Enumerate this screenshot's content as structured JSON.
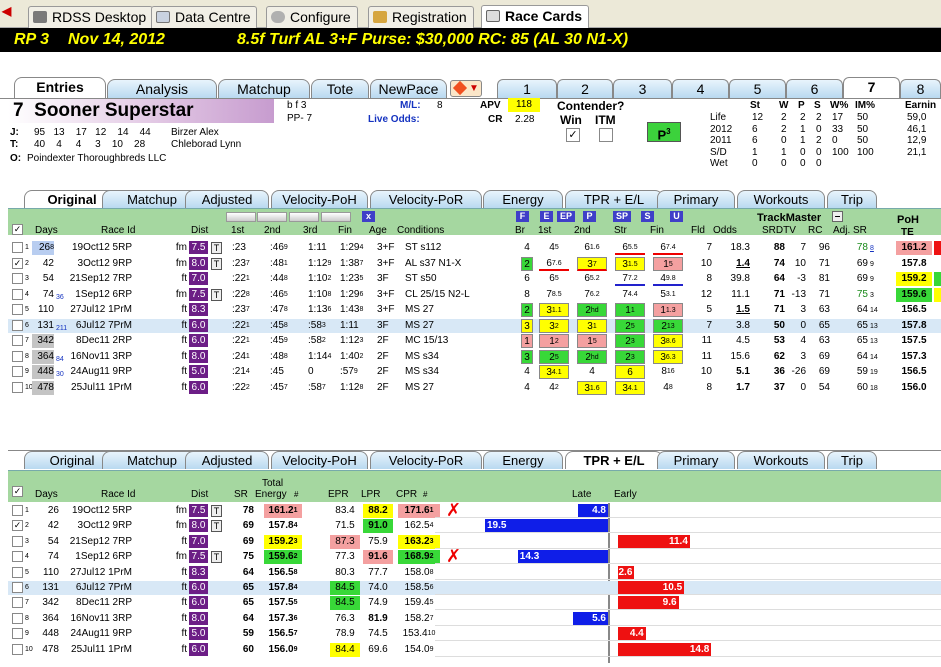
{
  "app_tabs": [
    {
      "label": "RDSS Desktop",
      "icon": "house-icon"
    },
    {
      "label": "Data Centre",
      "icon": "document-icon"
    },
    {
      "label": "Configure",
      "icon": "gear-icon"
    },
    {
      "label": "Registration",
      "icon": "key-icon"
    },
    {
      "label": "Race Cards",
      "icon": "card-icon"
    }
  ],
  "header": {
    "race": "RP  3",
    "date": "Nov 14, 2012",
    "info": "8.5f  Turf  AL  3+F   Purse: $30,000   RC: 85  (AL 30 N1-X)"
  },
  "entry_tabs": [
    "Entries",
    "Analysis",
    "Matchup",
    "Tote",
    "NewPace"
  ],
  "num_tabs": [
    "1",
    "2",
    "3",
    "4",
    "5",
    "6",
    "7",
    "8"
  ],
  "horse": {
    "num": "7",
    "name": "Sooner Superstar",
    "sex": "b f 3",
    "pp": "PP- 7",
    "ml_label": "M/L:",
    "ml": "8",
    "live_label": "Live Odds:",
    "apv_label": "APV",
    "apv": "118",
    "cr_label": "CR",
    "cr": "2.28",
    "contender": "Contender?",
    "win": "Win",
    "itm": "ITM",
    "p3": "P",
    "p3_sup": "3",
    "jockey_label": "J:",
    "jockey_stats": "95   13    17   12    14    44",
    "jockey": "Birzer Alex",
    "trainer_label": "T:",
    "trainer_stats": "40    4     4     3    10    28",
    "trainer": "Chleborad Lynn",
    "owner_label": "O:",
    "owner": "Poindexter Thoroughbreds LLC"
  },
  "record": {
    "headers": [
      "St",
      "W",
      "P",
      "S",
      "W%",
      "IM%",
      "Earnin"
    ],
    "rows": [
      {
        "label": "Life",
        "vals": [
          "12",
          "2",
          "2",
          "2",
          "17",
          "50",
          "59,0"
        ]
      },
      {
        "label": "2012",
        "vals": [
          "6",
          "2",
          "1",
          "0",
          "33",
          "50",
          "46,1"
        ]
      },
      {
        "label": "2011",
        "vals": [
          "6",
          "0",
          "1",
          "2",
          "0",
          "50",
          "12,9"
        ]
      },
      {
        "label": "S/D",
        "vals": [
          "1",
          "1",
          "0",
          "0",
          "100",
          "100",
          "21,1"
        ]
      },
      {
        "label": "Wet",
        "vals": [
          "0",
          "0",
          "0",
          "0",
          "",
          "",
          " "
        ]
      }
    ]
  },
  "form_tabs": [
    "Original",
    "Matchup",
    "Adjusted",
    "Velocity-PoH",
    "Velocity-PoR",
    "Energy",
    "TPR + E/L",
    "Primary",
    "Workouts",
    "Trip"
  ],
  "top_grid": {
    "headers": {
      "days": "Days",
      "raceid": "Race Id",
      "dist": "Dist",
      "c1st": "1st",
      "c2nd": "2nd",
      "c3rd": "3rd",
      "fin": "Fin",
      "age": "Age",
      "cond": "Conditions",
      "br": "Br",
      "b1st": "1st",
      "b2nd": "2nd",
      "str": "Str",
      "bfin": "Fin",
      "fld": "Fld",
      "odds": "Odds",
      "tm": "TrackMaster",
      "srdtv": "SRDTV",
      "rc": "RC",
      "adjsr": "Adj. SR",
      "poh": "PoH",
      "te": "TE",
      "x": "x",
      "F": "F",
      "E": "E",
      "EP": "EP",
      "P": "P",
      "SP": "SP",
      "S": "S",
      "U": "U",
      "minus": "–"
    },
    "rows": [
      {
        "n": "1",
        "days": "26",
        "dsup": "8",
        "rid": "19Oct12 5RP",
        "sf": "fm",
        "dist": "7.5",
        "t": "T",
        "f1": ":23",
        "f2": ":46",
        "f2s": "9",
        "f3": "1:11",
        "fin": "1:29",
        "fins": "4",
        "age": "3+F",
        "cond": "ST s112",
        "br": "4",
        "p1": "4",
        "p1s": "5",
        "p2": "6",
        "p2s": "1.6",
        "st": "6",
        "sts": "5.5",
        "pf": "6",
        "pfs": "7.4",
        "fld": "7",
        "odds": "18.3",
        "sr": "88",
        "dtv": "7",
        "rc": "96",
        "adj": "78",
        "adjs": "8",
        "poh": "161.2",
        "te": ""
      },
      {
        "n": "2",
        "chk": "✓",
        "days": "42",
        "rid": "3Oct12 9RP",
        "sf": "fm",
        "dist": "8.0",
        "t": "T",
        "f1": ":23",
        "f1s": "7",
        "f2": ":48",
        "f2s": "1",
        "f3": "1:12",
        "f3s": "9",
        "fin": "1:38",
        "fins": "7",
        "age": "3+F",
        "cond": "AL s37 N1-X",
        "br": "2",
        "p1": "6",
        "p1s": "7.6",
        "p2": "3",
        "p2s": "7",
        "st": "3",
        "sts": "1.5",
        "pf": "1",
        "pfs": "5",
        "fld": "10",
        "odds": "1.4",
        "sr": "74",
        "dtv": "10",
        "rc": "71",
        "adj": "69",
        "adjs": "9",
        "poh": "157.8",
        "te": ""
      },
      {
        "n": "3",
        "days": "54",
        "rid": "21Sep12 7RP",
        "sf": "ft",
        "dist": "7.0",
        "t": "",
        "f1": ":22",
        "f1s": "1",
        "f2": ":44",
        "f2s": "8",
        "f3": "1:10",
        "f3s": "2",
        "fin": "1:23",
        "fins": "5",
        "age": "3F",
        "cond": "ST s50",
        "br": "6",
        "p1": "6",
        "p1s": "5",
        "p2": "6",
        "p2s": "5.2",
        "st": "7",
        "sts": "7.2",
        "pf": "4",
        "pfs": "9.8",
        "fld": "8",
        "odds": "39.8",
        "sr": "64",
        "dtv": "-3",
        "rc": "81",
        "adj": "69",
        "adjs": "9",
        "poh": "159.2",
        "te": ""
      },
      {
        "n": "4",
        "days": "74",
        "dsup2": "36",
        "rid": "1Sep12 6RP",
        "sf": "fm",
        "dist": "7.5",
        "t": "T",
        "f1": ":22",
        "f1s": "8",
        "f2": ":46",
        "f2s": "5",
        "f3": "1:10",
        "f3s": "8",
        "fin": "1:29",
        "fins": "6",
        "age": "3+F",
        "cond": "CL 25/15 N2-L",
        "br": "8",
        "p1": "7",
        "p1s": "8.5",
        "p2": "7",
        "p2s": "6.2",
        "st": "7",
        "sts": "4.4",
        "pf": "5",
        "pfs": "3.1",
        "fld": "12",
        "odds": "11.1",
        "sr": "71",
        "dtv": "-13",
        "rc": "71",
        "adj": "75",
        "adjs": "3",
        "poh": "159.6",
        "te": ""
      },
      {
        "n": "5",
        "days": "110",
        "rid": "27Jul12 1PrM",
        "sf": "ft",
        "dist": "8.3",
        "t": "",
        "f1": ":23",
        "f1s": "7",
        "f2": ":47",
        "f2s": "8",
        "f3": "1:13",
        "f3s": "6",
        "fin": "1:43",
        "fins": "8",
        "age": "3+F",
        "cond": "MS 27",
        "br": "2",
        "p1": "3",
        "p1s": "1.1",
        "p2": "2",
        "p2s": "hd",
        "st": "1",
        "sts": "1",
        "pf": "1",
        "pfs": "1.3",
        "fld": "5",
        "odds": "1.5",
        "sr": "71",
        "dtv": "3",
        "rc": "63",
        "adj": "64",
        "adjs": "14",
        "poh": "156.5",
        "te": ""
      },
      {
        "n": "6",
        "days": "131",
        "dsup2": "211",
        "rid": "6Jul12 7PrM",
        "sf": "ft",
        "dist": "6.0",
        "t": "",
        "f1": ":22",
        "f1s": "1",
        "f2": ":45",
        "f2s": "8",
        "f3": ":58",
        "f3s": "3",
        "fin": "1:11",
        "fins": "",
        "age": "3F",
        "cond": "MS 27",
        "br": "3",
        "p1": "3",
        "p1s": "2",
        "p2": "3",
        "p2s": "1",
        "st": "2",
        "sts": "5",
        "pf": "2",
        "pfs": "13",
        "fld": "7",
        "odds": "3.8",
        "sr": "50",
        "dtv": "0",
        "rc": "65",
        "adj": "65",
        "adjs": "13",
        "poh": "157.8",
        "te": ""
      },
      {
        "n": "7",
        "days": "342",
        "rid": "8Dec11 2RP",
        "sf": "ft",
        "dist": "6.0",
        "t": "",
        "f1": ":22",
        "f1s": "1",
        "f2": ":45",
        "f2s": "9",
        "f3": ":58",
        "f3s": "2",
        "fin": "1:12",
        "fins": "3",
        "age": "2F",
        "cond": "MC 15/13",
        "br": "1",
        "p1": "1",
        "p1s": "2",
        "p2": "1",
        "p2s": "5",
        "st": "2",
        "sts": "3",
        "pf": "3",
        "pfs": "8.6",
        "fld": "11",
        "odds": "4.5",
        "sr": "53",
        "dtv": "4",
        "rc": "63",
        "adj": "65",
        "adjs": "13",
        "poh": "157.5",
        "te": ""
      },
      {
        "n": "8",
        "days": "364",
        "dsup2": "84",
        "rid": "16Nov11 3RP",
        "sf": "ft",
        "dist": "8.0",
        "t": "",
        "f1": ":24",
        "f1s": "1",
        "f2": ":48",
        "f2s": "8",
        "f3": "1:14",
        "f3s": "4",
        "fin": "1:40",
        "fins": "2",
        "age": "2F",
        "cond": "MS s34",
        "br": "3",
        "p1": "2",
        "p1s": "5",
        "p2": "2",
        "p2s": "hd",
        "st": "2",
        "sts": "3",
        "pf": "3",
        "pfs": "6.3",
        "fld": "11",
        "odds": "15.6",
        "sr": "62",
        "dtv": "3",
        "rc": "69",
        "adj": "64",
        "adjs": "14",
        "poh": "157.3",
        "te": ""
      },
      {
        "n": "9",
        "days": "448",
        "dsup2": "30",
        "rid": "24Aug11 9RP",
        "sf": "ft",
        "dist": "5.0",
        "t": "",
        "f1": ":21",
        "f1s": "4",
        "f2": ":45",
        "f2s": "",
        "f3": "0",
        "f3s": "",
        "fin": ":57",
        "fins": "9",
        "age": "2F",
        "cond": "MS s34",
        "br": "4",
        "p1": "3",
        "p1s": "4.1",
        "p2": "4",
        "p2s": "",
        "st": "6",
        "sts": "",
        "pf": "8",
        "pfs": "16",
        "fld": "10",
        "odds": "5.1",
        "sr": "36",
        "dtv": "-26",
        "rc": "69",
        "adj": "59",
        "adjs": "19",
        "poh": "156.5",
        "te": ""
      },
      {
        "n": "10",
        "days": "478",
        "rid": "25Jul11 1PrM",
        "sf": "ft",
        "dist": "6.0",
        "t": "",
        "f1": ":22",
        "f1s": "2",
        "f2": ":45",
        "f2s": "7",
        "f3": ":58",
        "f3s": "7",
        "fin": "1:12",
        "fins": "8",
        "age": "2F",
        "cond": "MS 27",
        "br": "4",
        "p1": "4",
        "p1s": "2",
        "p2": "3",
        "p2s": "1.6",
        "st": "3",
        "sts": "4.1",
        "pf": "4",
        "pfs": "8",
        "fld": "8",
        "odds": "1.7",
        "sr": "37",
        "dtv": "0",
        "rc": "54",
        "adj": "60",
        "adjs": "18",
        "poh": "156.0",
        "te": ""
      }
    ]
  },
  "bottom_grid": {
    "headers": {
      "days": "Days",
      "raceid": "Race Id",
      "dist": "Dist",
      "sr": "SR",
      "total": "Total",
      "energy": "Energy",
      "hash": "#",
      "epr": "EPR",
      "lpr": "LPR",
      "cpr": "CPR",
      "late": "Late",
      "early": "Early"
    },
    "rows": [
      {
        "n": "1",
        "days": "26",
        "rid": "19Oct12 5RP",
        "sf": "fm",
        "dist": "7.5",
        "t": "T",
        "sr": "78",
        "en": "161.2",
        "ens": "1",
        "epr": "83.4",
        "lpr": "88.2",
        "cpr": "171.6",
        "cprs": "1",
        "x": "✗",
        "late": "4.8",
        "early": ""
      },
      {
        "n": "2",
        "chk": "✓",
        "days": "42",
        "rid": "3Oct12 9RP",
        "sf": "fm",
        "dist": "8.0",
        "t": "T",
        "sr": "69",
        "en": "157.8",
        "ens": "4",
        "epr": "71.5",
        "lpr": "91.0",
        "cpr": "162.5",
        "cprs": "4",
        "late": "19.5",
        "early": ""
      },
      {
        "n": "3",
        "days": "54",
        "rid": "21Sep12 7RP",
        "sf": "ft",
        "dist": "7.0",
        "t": "",
        "sr": "69",
        "en": "159.2",
        "ens": "3",
        "epr": "87.3",
        "lpr": "75.9",
        "cpr": "163.2",
        "cprs": "3",
        "late": "",
        "early": "11.4"
      },
      {
        "n": "4",
        "days": "74",
        "rid": "1Sep12 6RP",
        "sf": "fm",
        "dist": "7.5",
        "t": "T",
        "sr": "75",
        "en": "159.6",
        "ens": "2",
        "epr": "77.3",
        "lpr": "91.6",
        "cpr": "168.9",
        "cprs": "2",
        "x": "✗",
        "late": "14.3",
        "early": ""
      },
      {
        "n": "5",
        "days": "110",
        "rid": "27Jul12 1PrM",
        "sf": "ft",
        "dist": "8.3",
        "t": "",
        "sr": "64",
        "en": "156.5",
        "ens": "8",
        "epr": "80.3",
        "lpr": "77.7",
        "cpr": "158.0",
        "cprs": "8",
        "late": "",
        "early": "2.6"
      },
      {
        "n": "6",
        "days": "131",
        "rid": "6Jul12 7PrM",
        "sf": "ft",
        "dist": "6.0",
        "t": "",
        "sr": "65",
        "en": "157.8",
        "ens": "4",
        "epr": "84.5",
        "lpr": "74.0",
        "cpr": "158.5",
        "cprs": "6",
        "late": "",
        "early": "10.5"
      },
      {
        "n": "7",
        "days": "342",
        "rid": "8Dec11 2RP",
        "sf": "ft",
        "dist": "6.0",
        "t": "",
        "sr": "65",
        "en": "157.5",
        "ens": "5",
        "epr": "84.5",
        "lpr": "74.9",
        "cpr": "159.4",
        "cprs": "5",
        "late": "",
        "early": "9.6"
      },
      {
        "n": "8",
        "days": "364",
        "rid": "16Nov11 3RP",
        "sf": "ft",
        "dist": "8.0",
        "t": "",
        "sr": "64",
        "en": "157.3",
        "ens": "6",
        "epr": "76.3",
        "lpr": "81.9",
        "cpr": "158.2",
        "cprs": "7",
        "late": "5.6",
        "early": ""
      },
      {
        "n": "9",
        "days": "448",
        "rid": "24Aug11 9RP",
        "sf": "ft",
        "dist": "5.0",
        "t": "",
        "sr": "59",
        "en": "156.5",
        "ens": "7",
        "epr": "78.9",
        "lpr": "74.5",
        "cpr": "153.4",
        "cprs": "10",
        "late": "",
        "early": "4.4"
      },
      {
        "n": "10",
        "days": "478",
        "rid": "25Jul11 1PrM",
        "sf": "ft",
        "dist": "6.0",
        "t": "",
        "sr": "60",
        "en": "156.0",
        "ens": "9",
        "epr": "84.4",
        "lpr": "69.6",
        "cpr": "154.0",
        "cprs": "9",
        "late": "",
        "early": "14.8"
      }
    ]
  },
  "colors": {
    "purple": "#6c1e86",
    "yellow": "#ffff00",
    "green": "#38d838",
    "pink": "#f4a0a0",
    "red": "#ee1111",
    "blue": "#0f1ee8",
    "header_bg": "#000000",
    "header_fg": "#ffff00"
  }
}
